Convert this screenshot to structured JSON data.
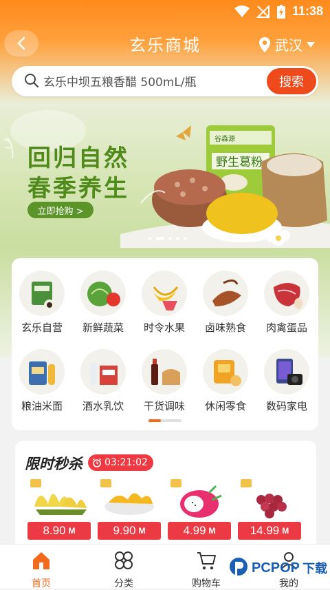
{
  "statusbar": {
    "time": "11:38"
  },
  "header": {
    "title": "玄乐商城",
    "city": "武汉"
  },
  "search": {
    "placeholder": "玄乐中坝五粮香醋 500mL/瓶",
    "button_label": "搜索"
  },
  "banner": {
    "line1": "回归自然",
    "line2": "春季养生",
    "cta": "立即抢购 >",
    "product_packet_text": "野生葛粉",
    "product_brand_text": "谷森源",
    "slide_count": 5,
    "active_slide": 1
  },
  "categories": [
    {
      "label": "玄乐自营",
      "icon": "self-operated-icon",
      "color": "#4a8f3a"
    },
    {
      "label": "新鲜蔬菜",
      "icon": "vegetable-icon",
      "color": "#3f8e2e"
    },
    {
      "label": "时令水果",
      "icon": "fruit-icon",
      "color": "#f4c21a"
    },
    {
      "label": "卤味熟食",
      "icon": "cooked-food-icon",
      "color": "#a6532a"
    },
    {
      "label": "肉禽蛋品",
      "icon": "meat-icon",
      "color": "#c8343a"
    },
    {
      "label": "粮油米面",
      "icon": "grain-oil-icon",
      "color": "#3b6fb0"
    },
    {
      "label": "酒水乳饮",
      "icon": "beverage-icon",
      "color": "#d8423a"
    },
    {
      "label": "干货调味",
      "icon": "seasoning-icon",
      "color": "#8a4b22"
    },
    {
      "label": "休闲零食",
      "icon": "snack-icon",
      "color": "#f0a324"
    },
    {
      "label": "数码家电",
      "icon": "electronics-icon",
      "color": "#3b4a8c"
    }
  ],
  "flash_sale": {
    "title": "限时秒杀",
    "countdown": "03:21:02",
    "items": [
      {
        "price": "8.90",
        "currency": "M",
        "image": "durian-icon"
      },
      {
        "price": "9.90",
        "currency": "M",
        "image": "jackfruit-icon"
      },
      {
        "price": "4.99",
        "currency": "M",
        "image": "dragonfruit-icon"
      },
      {
        "price": "14.99",
        "currency": "M",
        "image": "grape-icon"
      }
    ]
  },
  "tabbar": {
    "tabs": [
      {
        "label": "首页",
        "icon": "home-icon",
        "active": true
      },
      {
        "label": "分类",
        "icon": "category-icon",
        "active": false
      },
      {
        "label": "购物车",
        "icon": "cart-icon",
        "active": false
      },
      {
        "label": "我的",
        "icon": "profile-icon",
        "active": false
      }
    ]
  },
  "watermark": {
    "text": "PCPOP",
    "cn": "下载",
    "sub": "PCPOP Download"
  },
  "colors": {
    "accent": "#f26b1d",
    "search_button": "#ef4a1c",
    "price_tag": "#ec3a44",
    "banner_green": "#4f8a1a"
  }
}
